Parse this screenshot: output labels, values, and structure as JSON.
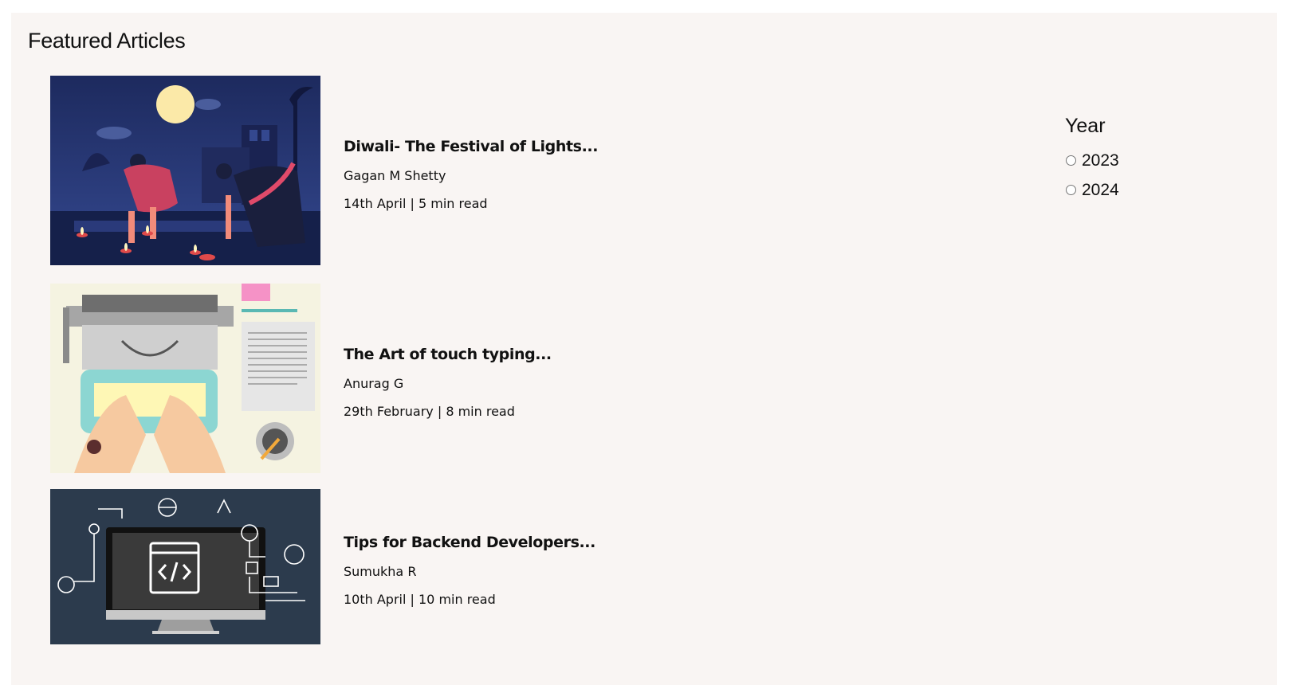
{
  "section": {
    "title": "Featured Articles"
  },
  "articles": [
    {
      "title": "Diwali- The Festival of Lights...",
      "author": "Gagan M Shetty",
      "info": "14th April | 5 min read",
      "image": "diwali-illustration"
    },
    {
      "title": "The Art of touch typing...",
      "author": "Anurag G",
      "info": "29th February | 8 min read",
      "image": "typewriter-illustration"
    },
    {
      "title": "Tips for Backend Developers...",
      "author": "Sumukha R",
      "info": "10th April | 10 min read",
      "image": "backend-developer-illustration"
    }
  ],
  "filter": {
    "title": "Year",
    "options": [
      {
        "label": "2023",
        "checked": false
      },
      {
        "label": "2024",
        "checked": false
      }
    ]
  },
  "colors": {
    "panel_background": "#f9f5f3",
    "text": "#111111"
  }
}
